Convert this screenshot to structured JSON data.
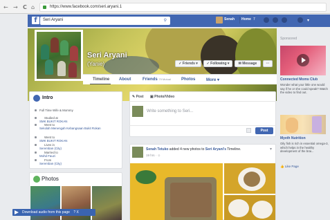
{
  "browser": {
    "back": "←",
    "forward": "→",
    "reload": "C",
    "home": "⌂",
    "url": "https://www.facebook.com/seri.aryani.1"
  },
  "fb": {
    "logo": "f",
    "search_value": "Seri Aryani",
    "user": "Senah",
    "home": "Home",
    "home_badge": "7"
  },
  "profile": {
    "name": "Seri Aryani",
    "nickname": "(Yanie)",
    "buttons": {
      "friends": "✓ Friends ▾",
      "following": "✓ Following ▾",
      "message": "✉ Message",
      "more": "···"
    },
    "tabs": {
      "timeline": "Timeline",
      "about": "About",
      "friends": "Friends",
      "friends_count": "79 Mutual",
      "photos": "Photos",
      "more": "More ▾"
    }
  },
  "intro": {
    "title": "Intro",
    "items": [
      {
        "text": "Full Time Wife & Mommy"
      },
      {
        "pre": "Studied at ",
        "link": "SMK BUKIT ROKAN"
      },
      {
        "pre": "Went to ",
        "link": "Sekolah Menengah Kebangsaan Bukit Rokan"
      },
      {
        "pre": "Went to ",
        "link": "SMK BUKIT ROKAN"
      },
      {
        "pre": "Lives in ",
        "link": "Seremban (City)"
      },
      {
        "pre": "Married to ",
        "link": "Mohd Fauzi"
      },
      {
        "pre": "From ",
        "link": "Seremban (City)"
      }
    ]
  },
  "photos": {
    "title": "Photos"
  },
  "download_bar": {
    "label": "Download audio from this page",
    "close": "?  X"
  },
  "composer": {
    "post_tab": "Post",
    "photo_tab": "Photo/Video",
    "placeholder": "Write something to Seri...",
    "post_button": "Post"
  },
  "feed_post": {
    "author": "Senah Tetuko",
    "action": " added 4 new photos to ",
    "target": "Seri Aryani's",
    "tail": " Timeline.",
    "time": "19 hrs · ☺"
  },
  "sidebar": {
    "sponsored": "Sponsored",
    "ads": [
      {
        "title": "Connected Moms Club",
        "desc": "Wonder what your little one would say if he or she could speak? Watch the video to find out."
      },
      {
        "title": "Myeth Nutrition",
        "desc": "Oily fish is rich in essential omega-3, which helps in the healthy development of the brai...",
        "like": "👍 Like Page"
      }
    ]
  },
  "colors": {
    "fb_blue": "#4267b2",
    "link": "#365899",
    "bg": "#e9ebee"
  }
}
